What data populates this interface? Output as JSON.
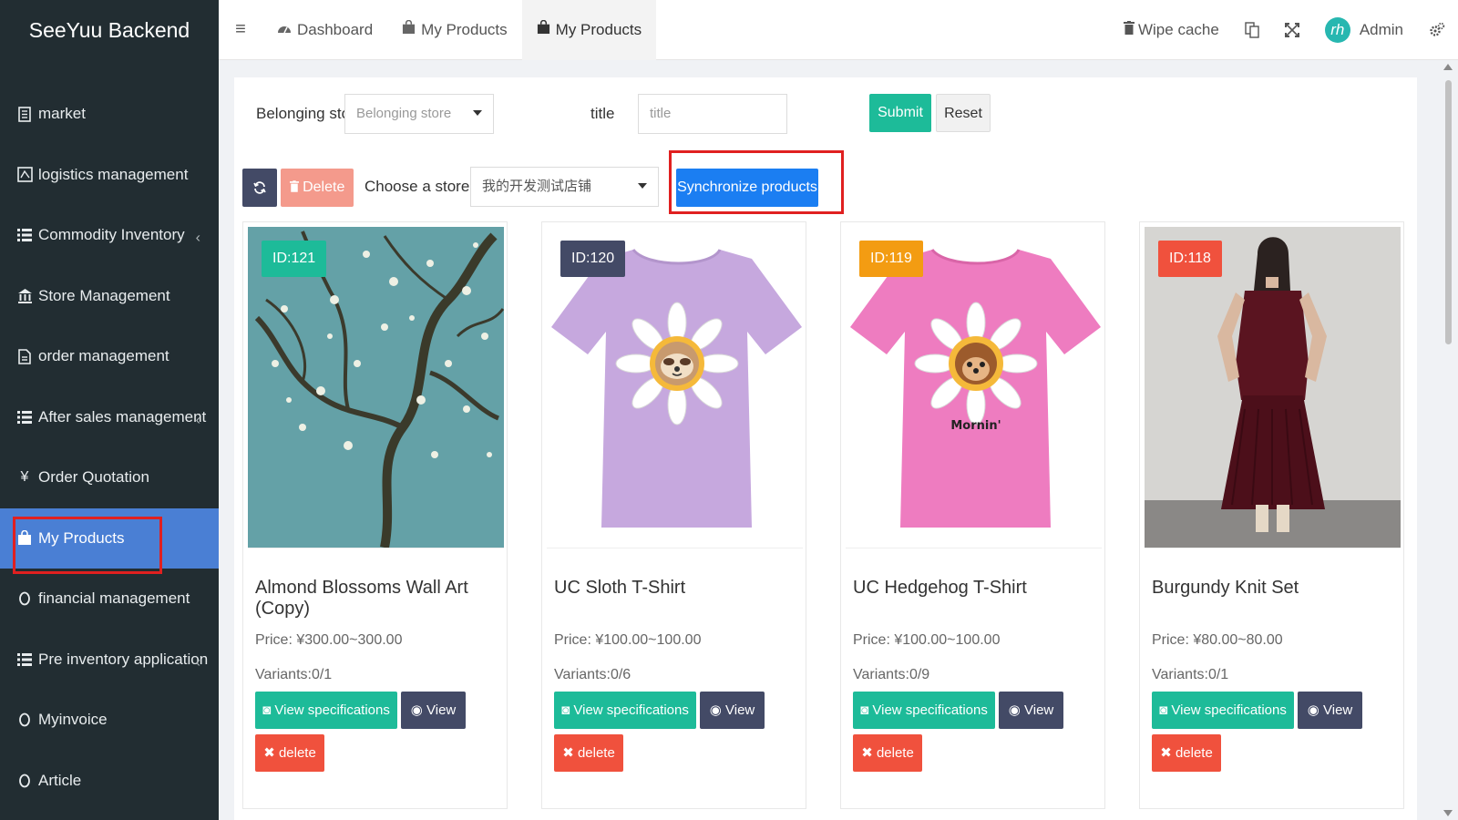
{
  "app": {
    "title": "SeeYuu Backend"
  },
  "sidebar": {
    "items": [
      {
        "label": "market",
        "icon": "document-icon",
        "chevron": false
      },
      {
        "label": "logistics management",
        "icon": "map-icon",
        "chevron": false
      },
      {
        "label": "Commodity Inventory",
        "icon": "list-icon",
        "chevron": true
      },
      {
        "label": "Store Management",
        "icon": "bank-icon",
        "chevron": false
      },
      {
        "label": "order management",
        "icon": "file-icon",
        "chevron": false
      },
      {
        "label": "After sales management",
        "icon": "list-icon",
        "chevron": true
      },
      {
        "label": "Order Quotation",
        "icon": "yen-icon",
        "chevron": false
      },
      {
        "label": "My Products",
        "icon": "shopping-bag-icon",
        "chevron": false,
        "active": true
      },
      {
        "label": "financial management",
        "icon": "circle-icon",
        "chevron": false
      },
      {
        "label": "Pre inventory application",
        "icon": "list-icon",
        "chevron": true
      },
      {
        "label": "Myinvoice",
        "icon": "circle-icon",
        "chevron": false
      },
      {
        "label": "Article",
        "icon": "circle-icon",
        "chevron": false
      }
    ],
    "active_color": "#4a7fd4"
  },
  "header": {
    "tabs": [
      {
        "label": "Dashboard",
        "icon": "dashboard-icon"
      },
      {
        "label": "My Products",
        "icon": "shopping-bag-icon"
      },
      {
        "label": "My Products",
        "icon": "shopping-bag-icon",
        "current": true
      }
    ],
    "wipe_cache": "Wipe cache",
    "user": "Admin",
    "avatar_text": "rh"
  },
  "filters": {
    "store_label": "Belonging store",
    "store_placeholder": "Belonging store",
    "title_label": "title",
    "title_placeholder": "title",
    "submit": "Submit",
    "reset": "Reset"
  },
  "toolbar": {
    "delete": "Delete",
    "choose_store_label": "Choose a store :",
    "store_value": "我的开发测试店铺",
    "sync": "Synchronize products"
  },
  "products": [
    {
      "id": "ID:121",
      "badge_color": "#1dbb99",
      "name": "Almond Blossoms Wall Art (Copy)",
      "price": "Price: ¥300.00~300.00",
      "variants": "Variants:0/1",
      "spec": "View specifications",
      "view": "View",
      "delete": "delete",
      "image": "almond-blossom-painting"
    },
    {
      "id": "ID:120",
      "badge_color": "#434a66",
      "name": "UC Sloth T-Shirt",
      "price": "Price: ¥100.00~100.00",
      "variants": "Variants:0/6",
      "spec": "View specifications",
      "view": "View",
      "delete": "delete",
      "image": "lavender-tshirt-sloth"
    },
    {
      "id": "ID:119",
      "badge_color": "#f39c12",
      "name": "UC Hedgehog T-Shirt",
      "price": "Price: ¥100.00~100.00",
      "variants": "Variants:0/9",
      "spec": "View specifications",
      "view": "View",
      "delete": "delete",
      "image": "pink-tshirt-hedgehog",
      "print_text": "Mornin'"
    },
    {
      "id": "ID:118",
      "badge_color": "#f0513d",
      "name": "Burgundy Knit Set",
      "price": "Price: ¥80.00~80.00",
      "variants": "Variants:0/1",
      "spec": "View specifications",
      "view": "View",
      "delete": "delete",
      "image": "woman-burgundy-outfit"
    }
  ]
}
